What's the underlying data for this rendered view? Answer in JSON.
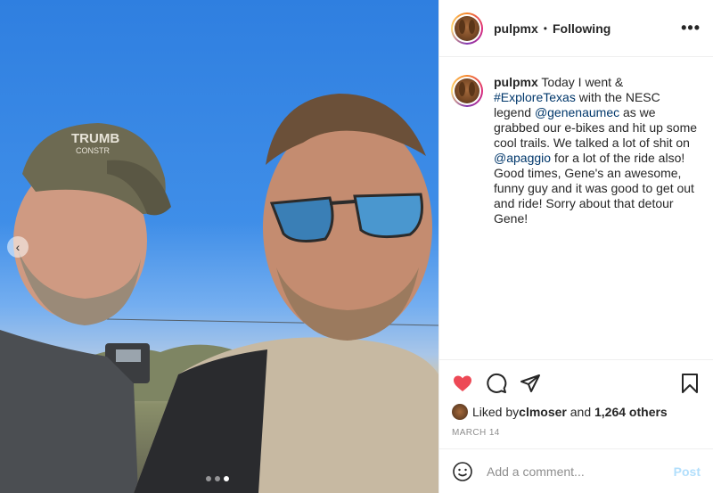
{
  "post": {
    "header": {
      "username": "pulpmx",
      "separator": "•",
      "follow_status": "Following",
      "more_glyph": "•••"
    },
    "caption": {
      "username": "pulpmx",
      "segments": {
        "t1": " Today I went & ",
        "hashtag": "#ExploreTexas",
        "t2": " with the NESC legend ",
        "mention1": "@genenaumec",
        "t3": " as we grabbed our e-bikes and hit up some cool trails. We talked a lot of shit on ",
        "mention2": "@apaggio",
        "t4": " for a lot of the ride also! Good times, Gene's an awesome, funny guy and it was good to get out and ride! Sorry about that detour Gene!"
      }
    },
    "likes": {
      "prefix": "Liked by ",
      "liker": "clmoser",
      "middle": " and ",
      "count": "1,264 others"
    },
    "date": "MARCH 14",
    "comment": {
      "placeholder": "Add a comment...",
      "post_label": "Post"
    },
    "carousel": {
      "prev_glyph": "‹",
      "dots": 3,
      "active_dot": 3
    },
    "photo_text": {
      "cap_line1": "TRUMB",
      "cap_line2": "CONSTR"
    },
    "icons": [
      "heart-icon",
      "comment-icon",
      "share-icon",
      "bookmark-icon",
      "emoji-icon"
    ],
    "colors": {
      "heart": "#ed4956",
      "link": "#00376b",
      "post_button": "#b2dffc",
      "muted": "#8e8e8e"
    }
  }
}
